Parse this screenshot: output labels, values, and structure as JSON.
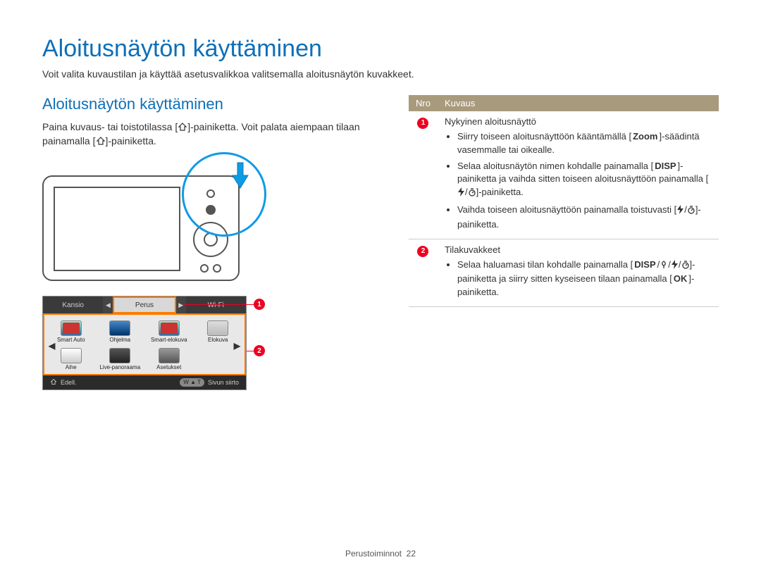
{
  "title": "Aloitusnäytön käyttäminen",
  "intro": "Voit valita kuvaustilan ja käyttää asetusvalikkoa valitsemalla aloitusnäytön kuvakkeet.",
  "left": {
    "section_title": "Aloitusnäytön käyttäminen",
    "instruction_pre": "Paina kuvaus- tai toistotilassa [",
    "instruction_mid": "]-painiketta. Voit palata aiempaan tilaan painamalla [",
    "instruction_post": "]-painiketta."
  },
  "home_screen": {
    "tabs": {
      "left": "Kansio",
      "center": "Perus",
      "right": "Wi-Fi"
    },
    "icons": [
      {
        "label": "Smart Auto",
        "cls": "smart"
      },
      {
        "label": "Ohjelma",
        "cls": "blue"
      },
      {
        "label": "Smart-elokuva",
        "cls": "smart"
      },
      {
        "label": "Elokuva",
        "cls": "movie"
      },
      {
        "label": "Aihe",
        "cls": "scene"
      },
      {
        "label": "Live-panoraama",
        "cls": "pano"
      },
      {
        "label": "Asetukset",
        "cls": "gear"
      }
    ],
    "back_label": "Edell.",
    "zoom_label": "Sivun siirto"
  },
  "callouts": {
    "c1": "1",
    "c2": "2"
  },
  "table": {
    "header_num": "Nro",
    "header_desc": "Kuvaus",
    "row1": {
      "title": "Nykyinen aloitusnäyttö",
      "b1_pre": "Siirry toiseen aloitusnäyttöön kääntämällä [",
      "b1_zoom": "Zoom",
      "b1_post": "]-säädintä vasemmalle tai oikealle.",
      "b2_pre": "Selaa aloitusnäytön nimen kohdalle painamalla [",
      "b2_disp": "DISP",
      "b2_mid": "]-painiketta ja vaihda sitten toiseen aloitusnäyttöön painamalla [",
      "b2_post": "]-painiketta.",
      "b3_pre": "Vaihda toiseen aloitusnäyttöön painamalla toistuvasti [",
      "b3_post": "]-painiketta."
    },
    "row2": {
      "title": "Tilakuvakkeet",
      "b1_pre": "Selaa haluamasi tilan kohdalle painamalla [",
      "b1_disp": "DISP",
      "b1_mid": "]-painiketta ja siirry sitten kyseiseen tilaan painamalla [",
      "b1_ok": "OK",
      "b1_post": "]-painiketta."
    }
  },
  "footer": {
    "section": "Perustoiminnot",
    "page": "22"
  }
}
